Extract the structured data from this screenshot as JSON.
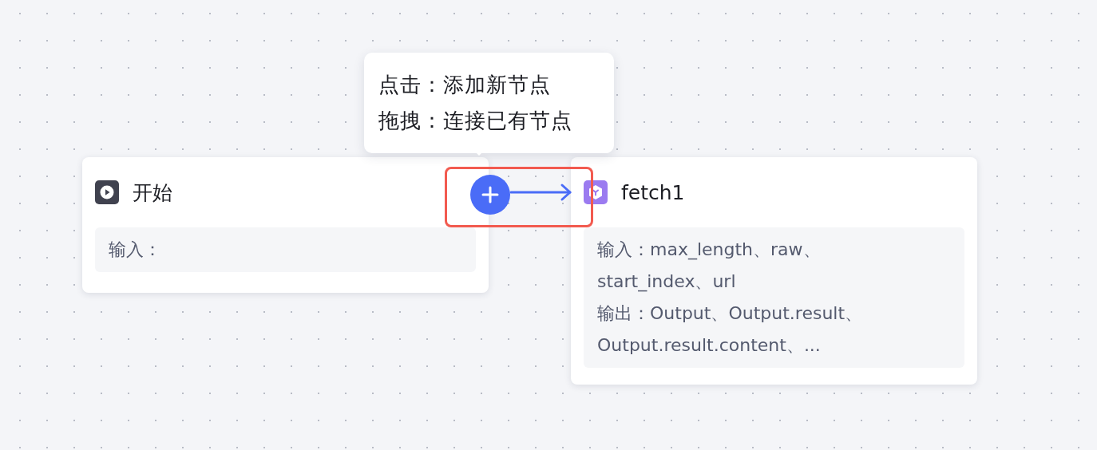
{
  "canvas": {
    "nodes": [
      {
        "kind": "start",
        "title": "开始",
        "details": [
          "输入："
        ]
      },
      {
        "kind": "tool",
        "title": "fetch1",
        "details": [
          "输入：max_length、raw、start_index、url",
          "输出：Output、Output.result、Output.result.content、..."
        ]
      }
    ],
    "tooltip": {
      "lines": [
        "点击：添加新节点",
        "拖拽：连接已有节点"
      ]
    },
    "highlight": {
      "kind": "box",
      "color": "#f25a4f"
    }
  }
}
